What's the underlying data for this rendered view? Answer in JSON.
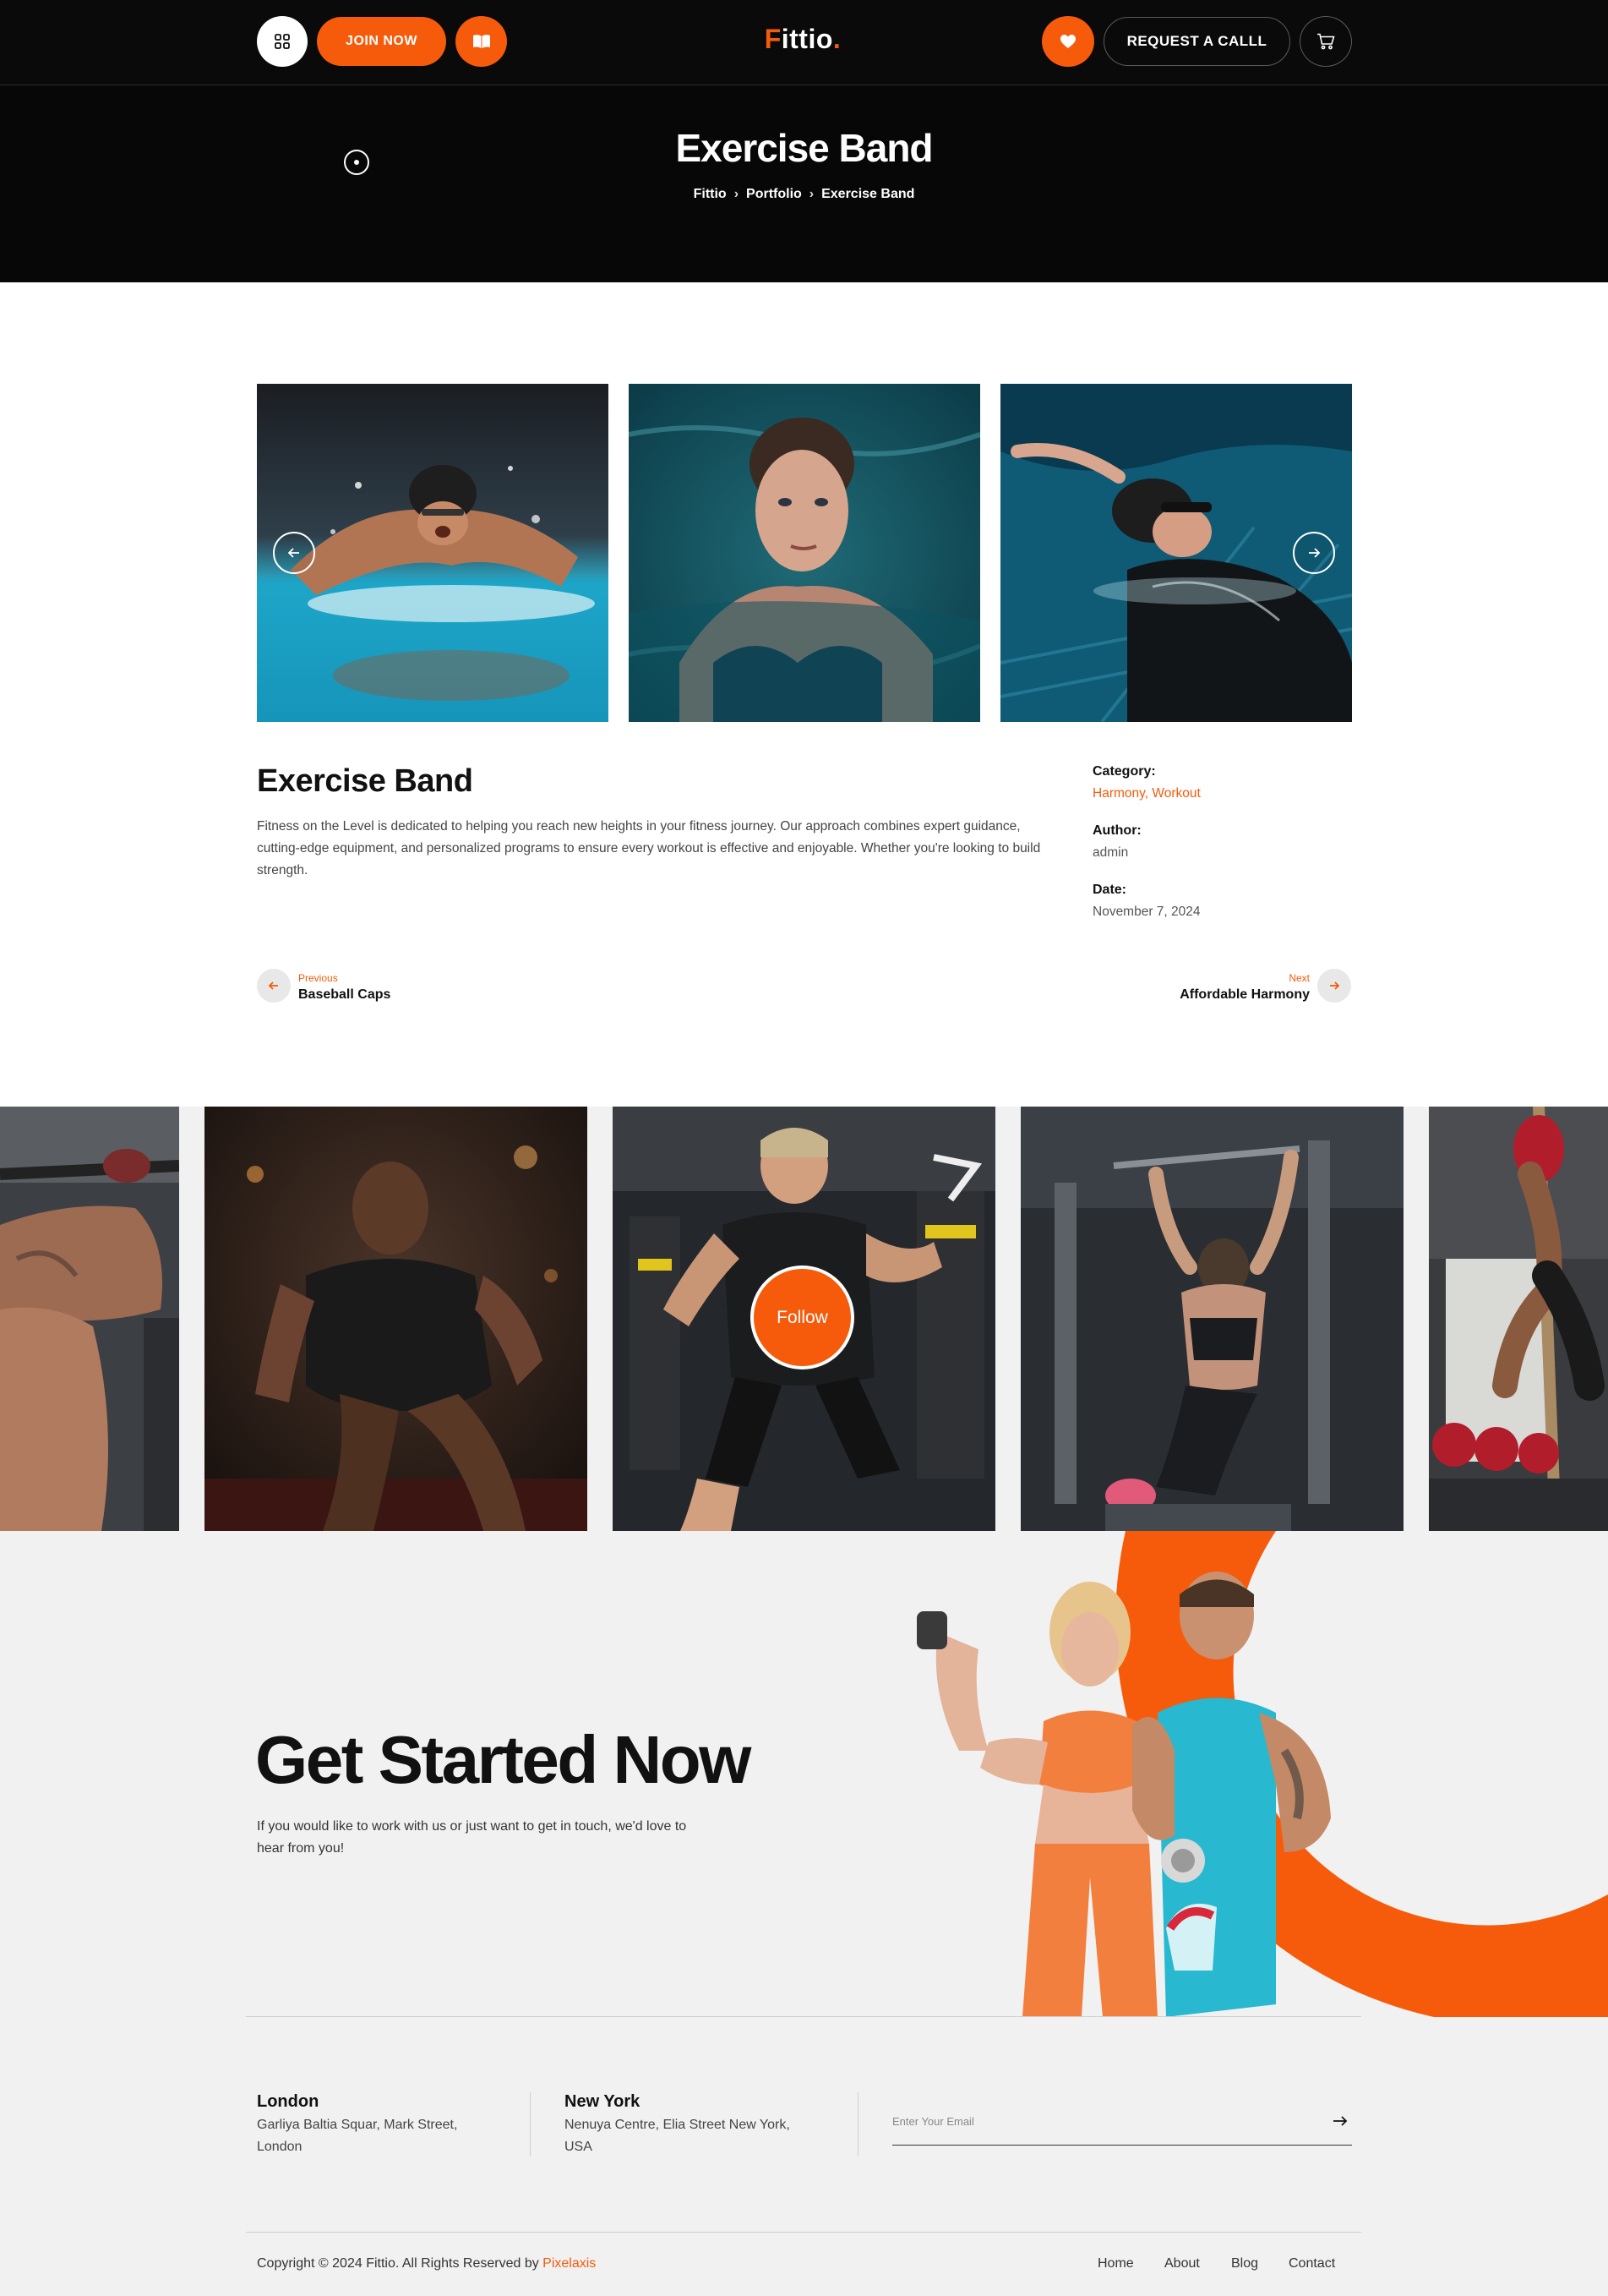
{
  "header": {
    "join_label": "JOIN NOW",
    "logo_text": "Fittio",
    "logo_dot": ".",
    "request_label": "REQUEST A CALLL",
    "icons": [
      "grid-icon",
      "book-icon",
      "heart-icon",
      "cart-icon"
    ]
  },
  "hero": {
    "title": "Exercise Band",
    "breadcrumb": [
      "Fittio",
      "Portfolio",
      "Exercise Band"
    ]
  },
  "project": {
    "title": "Exercise Band",
    "description": "Fitness on the Level is dedicated to helping you reach new heights in your fitness journey. Our approach combines expert guidance, cutting-edge equipment, and personalized programs to ensure every workout is effective and enjoyable. Whether you're looking to build strength.",
    "meta": {
      "category_label": "Category:",
      "categories": [
        "Harmony",
        "Workout"
      ],
      "category_sep": ", ",
      "author_label": "Author:",
      "author": "admin",
      "date_label": "Date:",
      "date": "November 7, 2024"
    },
    "prev": {
      "small": "Previous",
      "title": "Baseball Caps"
    },
    "next": {
      "small": "Next",
      "title": "Affordable Harmony"
    }
  },
  "gallery": {
    "images": [
      "swimmer-butterfly-photo",
      "woman-in-pool-photo",
      "swimmer-backstroke-photo"
    ]
  },
  "instagram": {
    "follow_label": "Follow",
    "images": [
      "pullup-photo",
      "sprinter-photo",
      "cable-trainer-photo",
      "lat-pulldown-photo",
      "rope-climb-photo"
    ]
  },
  "cta": {
    "title": "Get Started Now",
    "text": "If you would like to work with us or just want to get in touch, we'd love to hear from you!"
  },
  "contact": {
    "offices": [
      {
        "city": "London",
        "address": "Garliya Baltia Squar, Mark Street, London"
      },
      {
        "city": "New York",
        "address": "Nenuya Centre, Elia Street New York, USA"
      }
    ],
    "email_placeholder": "Enter Your Email"
  },
  "footer": {
    "copyright": "Copyright © 2024 Fittio. All Rights Reserved by ",
    "brand": "Pixelaxis",
    "links": [
      "Home",
      "About",
      "Blog",
      "Contact"
    ]
  },
  "colors": {
    "accent": "#f55b0a",
    "dark": "#0a0a0a",
    "light_bg": "#f1f1f1"
  }
}
